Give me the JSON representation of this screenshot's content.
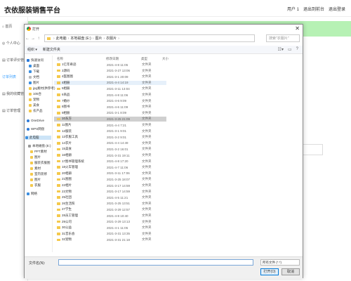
{
  "app": {
    "title": "衣依服装销售平台",
    "top_links": [
      "用户 1",
      "退出到前台",
      "退出登录"
    ]
  },
  "sidebar": {
    "items": [
      {
        "label": "首页",
        "active": false
      },
      {
        "label": "个人中心",
        "active": false
      },
      {
        "label": "订单评价管理",
        "active": false
      },
      {
        "label": "订单列表",
        "active": true
      },
      {
        "label": "我的收藏管理",
        "active": false
      },
      {
        "label": "订单管理",
        "active": false
      }
    ]
  },
  "dialog": {
    "title": "打开",
    "close_glyph": "✕",
    "address_parts": [
      "此电脑",
      "本地磁盘 (E:)",
      "图片",
      "衣服片"
    ],
    "search_placeholder": "搜索\"衣服片\"",
    "toolbar": {
      "organize": "组织 ▾",
      "new_folder": "新建文件夹"
    },
    "nav": {
      "quick_access": "快速访问",
      "items": [
        "桌面",
        "下载",
        "文档",
        "图片",
        "jpg素材(供参考)",
        "105合",
        "宠物",
        "美食",
        "农产品"
      ],
      "onedrive": "OneDrive",
      "wps": "WPS网盘",
      "this_pc": "此电脑",
      "drives": [
        "本地磁盘 (E:)",
        "PPT素材",
        "图片",
        "服装衣服图",
        "素材",
        "室内装修",
        "图片",
        "衣服"
      ],
      "network": "网络"
    },
    "columns": {
      "name": "名称",
      "date": "修改日期",
      "type": "类型",
      "size": "大小"
    },
    "files": [
      {
        "name": "1亿年奇迹",
        "date": "2021-4-8 11:05",
        "type": "文件夹"
      },
      {
        "name": "3源码",
        "date": "2021-3-27 13:06",
        "type": "文件夹"
      },
      {
        "name": "4医图图",
        "date": "2021-3-1 20:09",
        "type": "文件夹"
      },
      {
        "name": "4相册",
        "date": "2021-4-4 14:19",
        "type": "文件夹"
      },
      {
        "name": "5相册",
        "date": "2021-3-11 13:04",
        "type": "文件夹"
      },
      {
        "name": "6商品",
        "date": "2021-4-8 11:06",
        "type": "文件夹"
      },
      {
        "name": "7婚纱",
        "date": "2021-4-6 9:09",
        "type": "文件夹"
      },
      {
        "name": "8图书",
        "date": "2021-4-6 11:09",
        "type": "文件夹"
      },
      {
        "name": "9相册",
        "date": "2021-3-1 8:09",
        "type": "文件夹"
      },
      {
        "name": "10东方",
        "date": "2021-3-25 21:09",
        "type": "文件夹"
      },
      {
        "name": "11图片",
        "date": "2021-4-4 7:21",
        "type": "文件夹"
      },
      {
        "name": "12服装",
        "date": "2021-3-1 9:01",
        "type": "文件夹"
      },
      {
        "name": "13衣服工具",
        "date": "2021-3-2 9:01",
        "type": "文件夹"
      },
      {
        "name": "14衣片",
        "date": "2021-4-4 14:49",
        "type": "文件夹"
      },
      {
        "name": "15美食",
        "date": "2021-3-2 16:01",
        "type": "文件夹"
      },
      {
        "name": "16相册",
        "date": "2021-3-31 19:11",
        "type": "文件夹"
      },
      {
        "name": "17图书管理系统",
        "date": "2021-4-8 17:20",
        "type": "文件夹"
      },
      {
        "name": "18火车管理",
        "date": "2021-4-7 11:06",
        "type": "文件夹"
      },
      {
        "name": "20相册",
        "date": "2021-3-11 17:06",
        "type": "文件夹"
      },
      {
        "name": "21图图",
        "date": "2021-3-25 18:07",
        "type": "文件夹"
      },
      {
        "name": "22相片",
        "date": "2021-3-17 14:59",
        "type": "文件夹"
      },
      {
        "name": "23文物",
        "date": "2021-3-17 14:59",
        "type": "文件夹"
      },
      {
        "name": "25社团",
        "date": "2021-4-5 11:21",
        "type": "文件夹"
      },
      {
        "name": "26生活照",
        "date": "2021-3-25 13:51",
        "type": "文件夹"
      },
      {
        "name": "27学生",
        "date": "2021-3-29 12:57",
        "type": "文件夹"
      },
      {
        "name": "28员工管理",
        "date": "2021-4-8 10:40",
        "type": "文件夹"
      },
      {
        "name": "29公司",
        "date": "2021-3-29 13:13",
        "type": "文件夹"
      },
      {
        "name": "30公益",
        "date": "2021-4-1 11:05",
        "type": "文件夹"
      },
      {
        "name": "31音乐会",
        "date": "2021-3-31 13:35",
        "type": "文件夹"
      },
      {
        "name": "32宠物",
        "date": "2021-3-31 21:18",
        "type": "文件夹"
      }
    ],
    "selected_index": 9,
    "hover_index": 3,
    "filename_label": "文件名(N):",
    "filename_value": "",
    "filter": "所有文件 (*.*)",
    "open_button": "打开(O)",
    "cancel_button": "取消"
  }
}
